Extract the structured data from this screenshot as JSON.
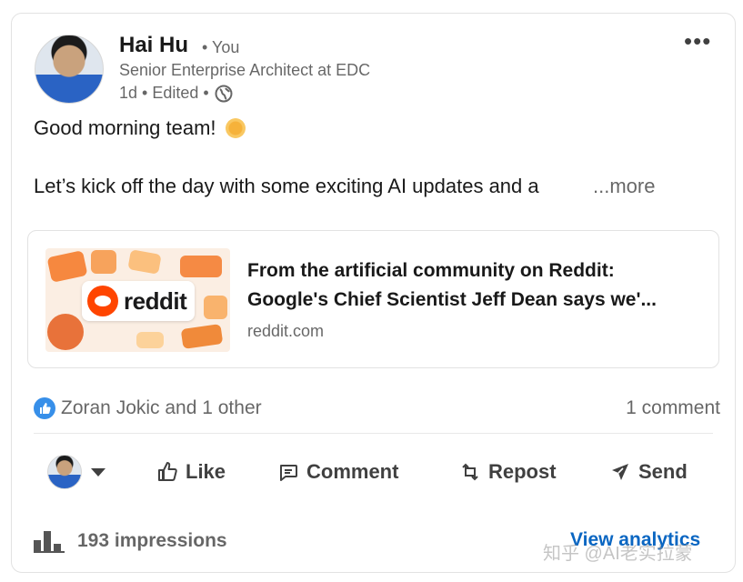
{
  "post": {
    "author": "Hai Hu",
    "you_tag": "• You",
    "headline": "Senior Enterprise Architect at EDC",
    "meta": "1d • Edited •",
    "menu_glyph": "•••",
    "line1": "Good morning team!",
    "line2": "Let’s kick off the day with some exciting AI updates and a",
    "see_more": "...more"
  },
  "link_preview": {
    "thumb_brand": "reddit",
    "title_line1": "From the artificial community on Reddit:",
    "title_line2": "Google's Chief Scientist Jeff Dean says we'...",
    "domain": "reddit.com"
  },
  "social": {
    "reactions_text": "Zoran Jokic and 1 other",
    "comments_text": "1 comment"
  },
  "actions": {
    "like": "Like",
    "comment": "Comment",
    "repost": "Repost",
    "send": "Send"
  },
  "footer": {
    "impressions": "193 impressions",
    "view_analytics": "View analytics"
  },
  "watermark": "知乎 @AI老实拉蒙",
  "colors": {
    "accent": "#0a66c2",
    "like_badge": "#378fe9",
    "reddit_orange": "#ff4500"
  }
}
